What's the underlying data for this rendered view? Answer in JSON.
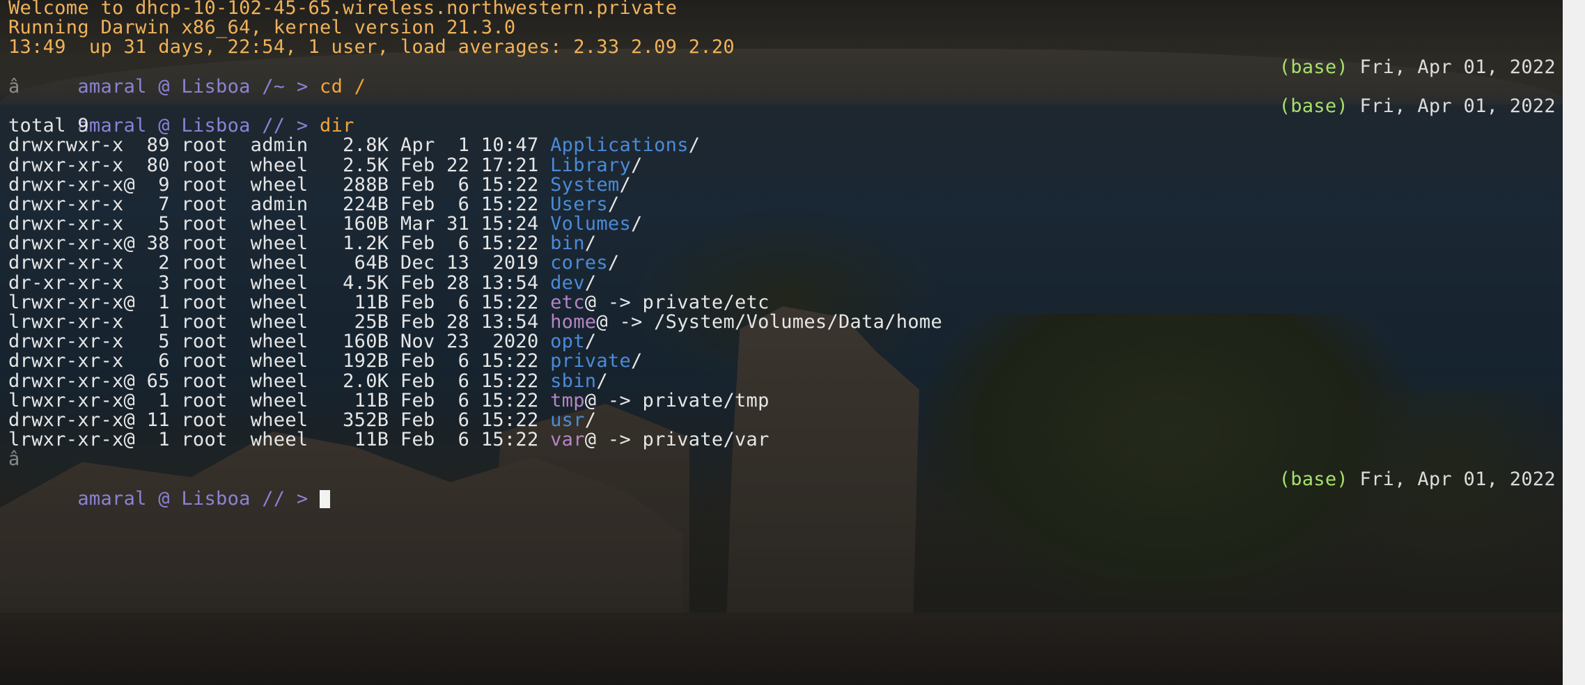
{
  "motd": [
    "Welcome to dhcp-10-102-45-65.wireless.northwestern.private",
    "Running Darwin x86_64, kernel version 21.3.0",
    "13:49  up 31 days, 22:54, 1 user, load averages: 2.33 2.09 2.20"
  ],
  "prompts": [
    {
      "text": "amaral @ Lisboa /~ > ",
      "command": "cd /",
      "env": "(base)",
      "date": "Fri, Apr 01, 2022"
    },
    {
      "text": "amaral @ Lisboa // > ",
      "command": "dir",
      "env": "(base)",
      "date": "Fri, Apr 01, 2022"
    },
    {
      "text": "amaral @ Lisboa // > ",
      "command": "",
      "env": "(base)",
      "date": "Fri, Apr 01, 2022"
    }
  ],
  "stray_char": "â",
  "listing_total": "total 9",
  "listing": [
    {
      "meta": "drwxrwxr-x  89 root  admin   2.8K Apr  1 10:47 ",
      "name": "Applications",
      "suffix": "/",
      "kind": "dir"
    },
    {
      "meta": "drwxr-xr-x  80 root  wheel   2.5K Feb 22 17:21 ",
      "name": "Library",
      "suffix": "/",
      "kind": "dir"
    },
    {
      "meta": "drwxr-xr-x@  9 root  wheel   288B Feb  6 15:22 ",
      "name": "System",
      "suffix": "/",
      "kind": "dir"
    },
    {
      "meta": "drwxr-xr-x   7 root  admin   224B Feb  6 15:22 ",
      "name": "Users",
      "suffix": "/",
      "kind": "dir"
    },
    {
      "meta": "drwxr-xr-x   5 root  wheel   160B Mar 31 15:24 ",
      "name": "Volumes",
      "suffix": "/",
      "kind": "dir"
    },
    {
      "meta": "drwxr-xr-x@ 38 root  wheel   1.2K Feb  6 15:22 ",
      "name": "bin",
      "suffix": "/",
      "kind": "dir"
    },
    {
      "meta": "drwxr-xr-x   2 root  wheel    64B Dec 13  2019 ",
      "name": "cores",
      "suffix": "/",
      "kind": "dir"
    },
    {
      "meta": "dr-xr-xr-x   3 root  wheel   4.5K Feb 28 13:54 ",
      "name": "dev",
      "suffix": "/",
      "kind": "dir"
    },
    {
      "meta": "lrwxr-xr-x@  1 root  wheel    11B Feb  6 15:22 ",
      "name": "etc",
      "suffix": "@ -> private/etc",
      "kind": "link"
    },
    {
      "meta": "lrwxr-xr-x   1 root  wheel    25B Feb 28 13:54 ",
      "name": "home",
      "suffix": "@ -> /System/Volumes/Data/home",
      "kind": "link"
    },
    {
      "meta": "drwxr-xr-x   5 root  wheel   160B Nov 23  2020 ",
      "name": "opt",
      "suffix": "/",
      "kind": "dir"
    },
    {
      "meta": "drwxr-xr-x   6 root  wheel   192B Feb  6 15:22 ",
      "name": "private",
      "suffix": "/",
      "kind": "dir"
    },
    {
      "meta": "drwxr-xr-x@ 65 root  wheel   2.0K Feb  6 15:22 ",
      "name": "sbin",
      "suffix": "/",
      "kind": "dir"
    },
    {
      "meta": "lrwxr-xr-x@  1 root  wheel    11B Feb  6 15:22 ",
      "name": "tmp",
      "suffix": "@ -> private/tmp",
      "kind": "link"
    },
    {
      "meta": "drwxr-xr-x@ 11 root  wheel   352B Feb  6 15:22 ",
      "name": "usr",
      "suffix": "/",
      "kind": "dir"
    },
    {
      "meta": "lrwxr-xr-x@  1 root  wheel    11B Feb  6 15:22 ",
      "name": "var",
      "suffix": "@ -> private/var",
      "kind": "link"
    }
  ],
  "colors": {
    "motd": "#f0b25a",
    "prompt": "#8a83d6",
    "command": "#f3a53a",
    "env": "#a6e06a",
    "directory": "#4b8bd8",
    "symlink": "#b485c4",
    "text": "#e6e6e6"
  }
}
